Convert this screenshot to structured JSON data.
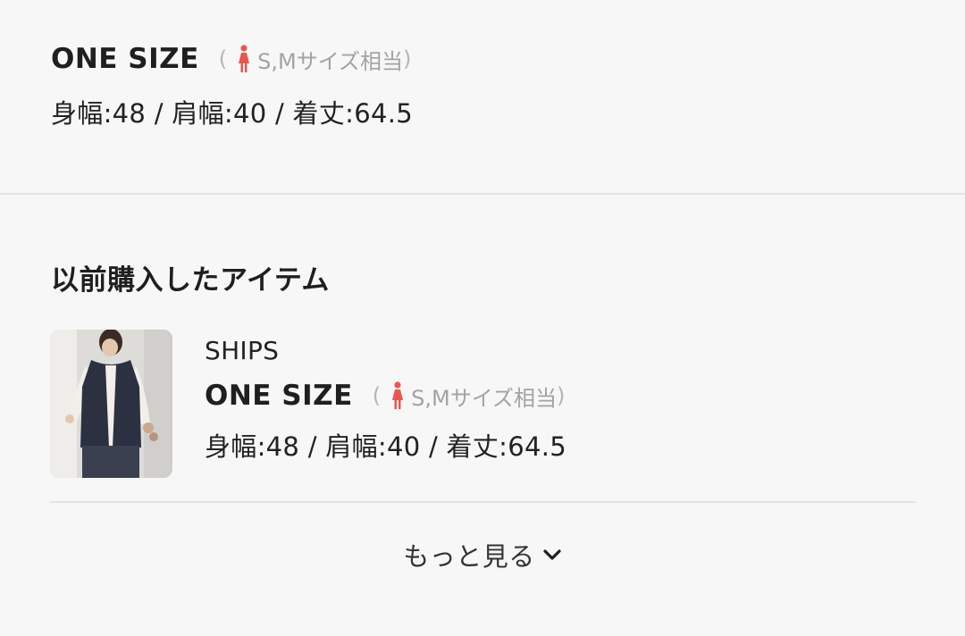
{
  "top": {
    "size_name": "ONE SIZE",
    "paren_open": "(",
    "size_equiv": "S,Mサイズ相当",
    "paren_close": ")",
    "measurements": "身幅:48 / 肩幅:40 / 着丈:64.5"
  },
  "previous": {
    "title": "以前購入したアイテム",
    "items": [
      {
        "brand": "SHIPS",
        "size_name": "ONE SIZE",
        "paren_open": "(",
        "size_equiv": "S,Mサイズ相当",
        "paren_close": ")",
        "measurements": "身幅:48 / 肩幅:40 / 着丈:64.5"
      }
    ]
  },
  "more": {
    "label": "もっと見る",
    "icon": "chevron-down-icon"
  },
  "colors": {
    "accent_person": "#e8574f",
    "muted_text": "#a3a3a3",
    "divider": "#e3e3e3",
    "background": "#f7f7f7"
  }
}
